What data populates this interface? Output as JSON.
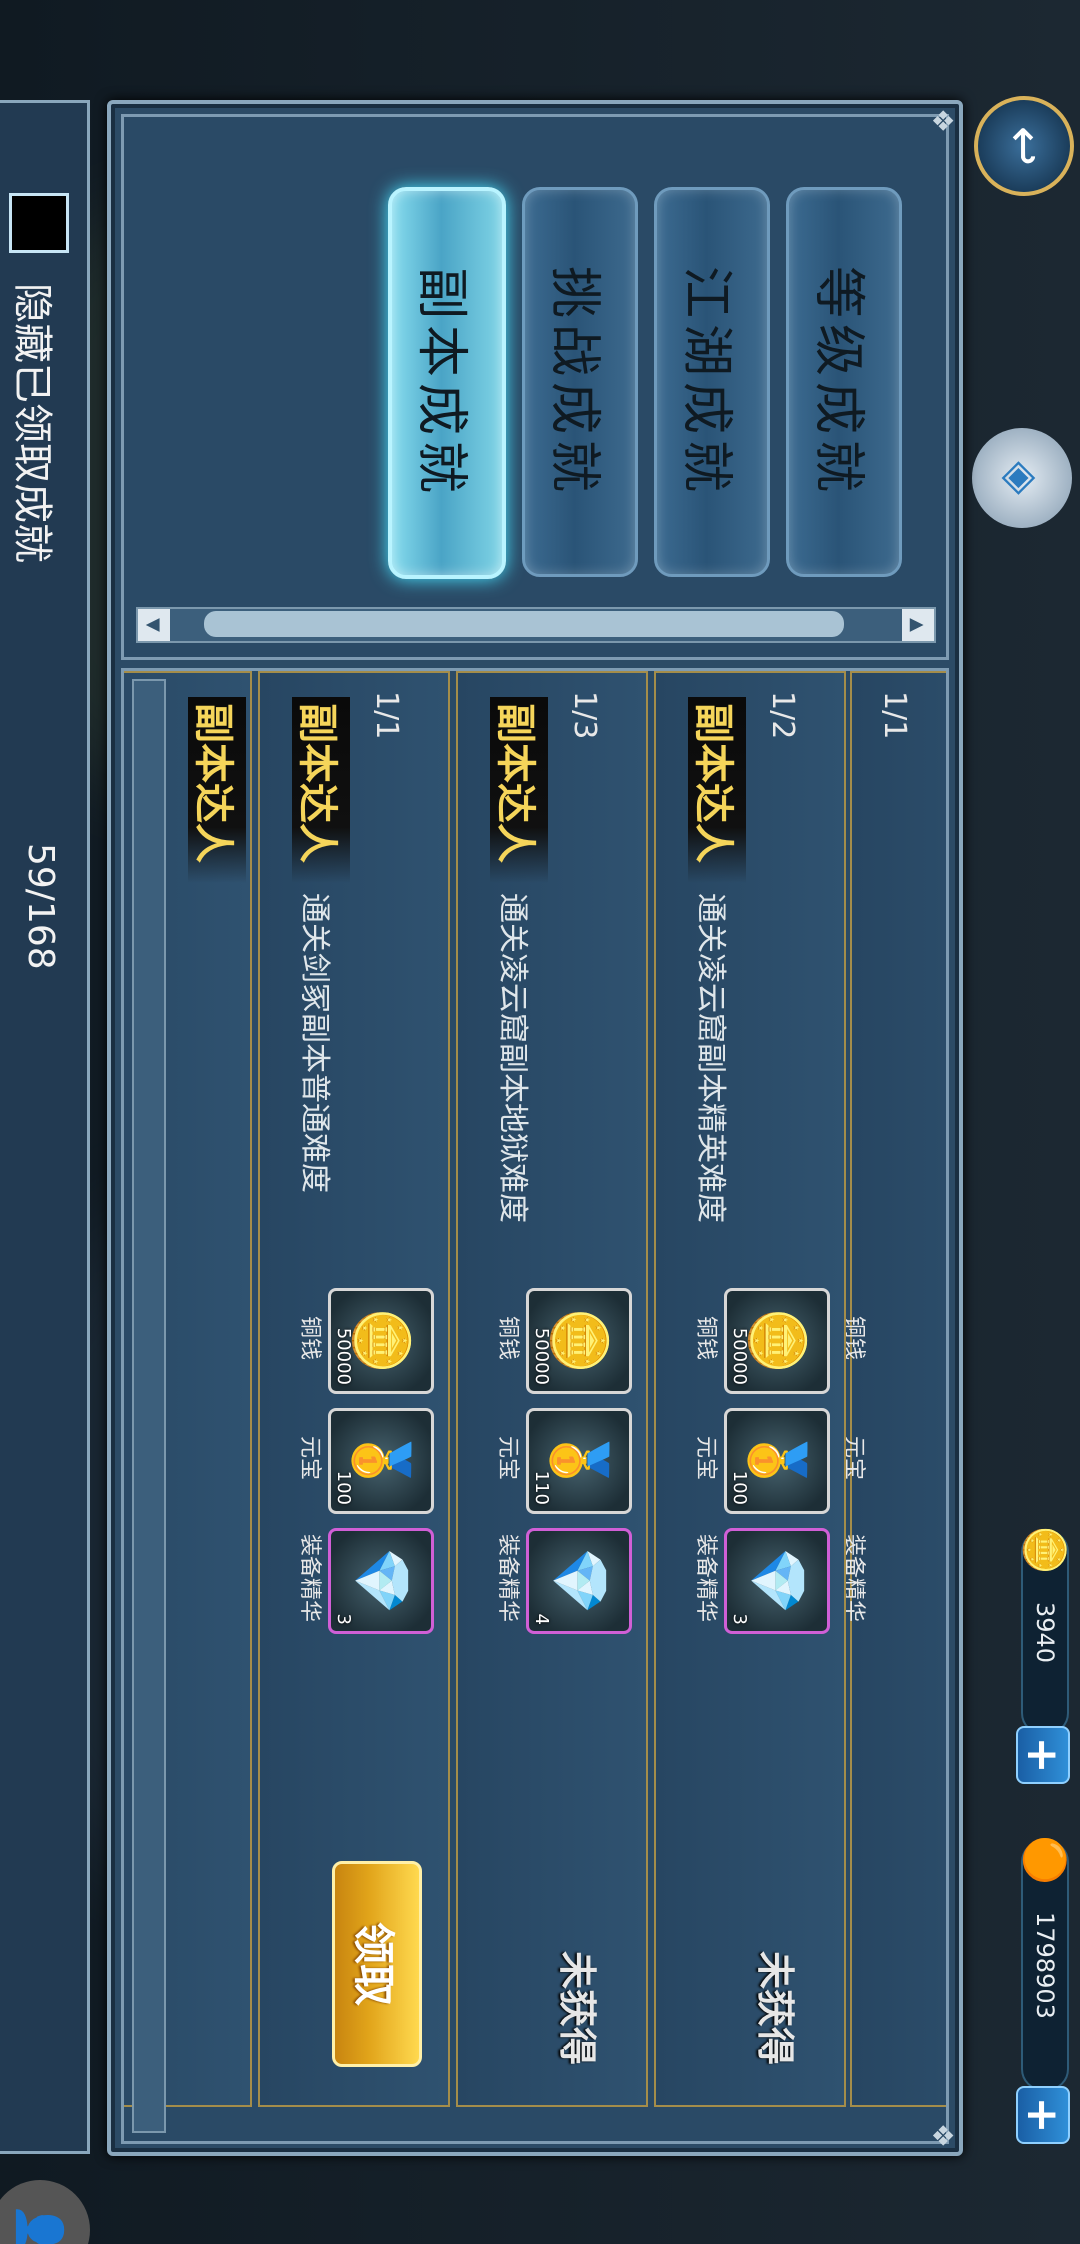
{
  "currencies": {
    "gold_ingot": {
      "value": "3940",
      "icon": "gold-ingot-icon"
    },
    "copper_coin": {
      "value": "1798903",
      "icon": "copper-coin-icon"
    }
  },
  "tabs": [
    {
      "label": "等级成就",
      "active": false
    },
    {
      "label": "江湖成就",
      "active": false
    },
    {
      "label": "挑战成就",
      "active": false
    },
    {
      "label": "副本成就",
      "active": true
    }
  ],
  "achievements": [
    {
      "progress": "1/1",
      "title": "",
      "description": "",
      "rewards": [
        {
          "label": "铜钱",
          "amount": ""
        },
        {
          "label": "元宝",
          "amount": ""
        },
        {
          "label": "装备精华",
          "amount": ""
        }
      ],
      "status": ""
    },
    {
      "progress": "1/2",
      "title": "副本达人",
      "description": "通关凌云窟副本精英难度",
      "rewards": [
        {
          "label": "铜钱",
          "amount": "50000"
        },
        {
          "label": "元宝",
          "amount": "100"
        },
        {
          "label": "装备精华",
          "amount": "3"
        }
      ],
      "status": "未获得"
    },
    {
      "progress": "1/3",
      "title": "副本达人",
      "description": "通关凌云窟副本地狱难度",
      "rewards": [
        {
          "label": "铜钱",
          "amount": "50000"
        },
        {
          "label": "元宝",
          "amount": "110"
        },
        {
          "label": "装备精华",
          "amount": "4"
        }
      ],
      "status": "未获得"
    },
    {
      "progress": "1/1",
      "title": "副本达人",
      "description": "通关剑冢副本普通难度",
      "rewards": [
        {
          "label": "铜钱",
          "amount": "50000"
        },
        {
          "label": "元宝",
          "amount": "100"
        },
        {
          "label": "装备精华",
          "amount": "3"
        }
      ],
      "status": "",
      "claim_label": "领取"
    },
    {
      "progress": "",
      "title": "副本达人",
      "description": "",
      "rewards": [],
      "status": ""
    }
  ],
  "footer": {
    "hide_claimed_label": "隐藏已领取成就",
    "count": "59/168"
  }
}
